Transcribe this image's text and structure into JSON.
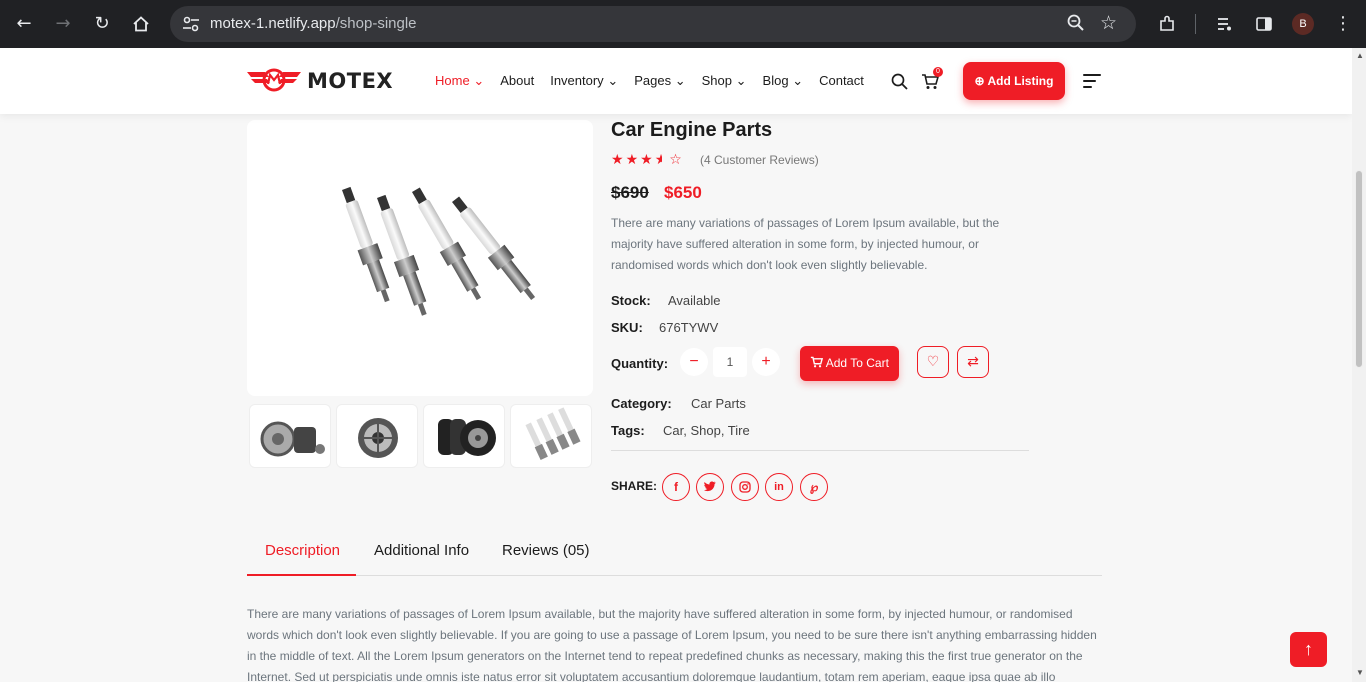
{
  "browser": {
    "url_host": "motex-1.netlify.app",
    "url_path": "/shop-single",
    "profile_initial": "B"
  },
  "nav": {
    "brand": "MOTEX",
    "menu": [
      {
        "label": "Home",
        "has_dropdown": true,
        "active": true
      },
      {
        "label": "About",
        "has_dropdown": false
      },
      {
        "label": "Inventory",
        "has_dropdown": true
      },
      {
        "label": "Pages",
        "has_dropdown": true
      },
      {
        "label": "Shop",
        "has_dropdown": true
      },
      {
        "label": "Blog",
        "has_dropdown": true
      },
      {
        "label": "Contact",
        "has_dropdown": false
      }
    ],
    "cart_count": "0",
    "add_listing_label": "Add Listing",
    "accent_color": "#ef1d26"
  },
  "product": {
    "title": "Car Engine Parts",
    "rating": 3.5,
    "rating_max": 5,
    "reviews_label": "(4 Customer Reviews)",
    "old_price": "$690",
    "new_price": "$650",
    "description": "There are many variations of passages of Lorem Ipsum available, but the majority have suffered alteration in some form, by injected humour, or randomised words which don't look even slightly believable.",
    "stock_label": "Stock:",
    "stock_value": "Available",
    "sku_label": "SKU:",
    "sku_value": "676TYWV",
    "quantity_label": "Quantity:",
    "quantity_value": "1",
    "add_to_cart_label": "Add To Cart",
    "category_label": "Category:",
    "category_value": "Car Parts",
    "tags_label": "Tags:",
    "tags_value": "Car, Shop, Tire",
    "share_label": "SHARE:",
    "thumbnails": [
      "brake-parts",
      "alternator",
      "tires",
      "spark-plugs"
    ]
  },
  "tabs": {
    "items": [
      "Description",
      "Additional Info",
      "Reviews (05)"
    ],
    "active": "Description"
  },
  "long_description": "There are many variations of passages of Lorem Ipsum available, but the majority have suffered alteration in some form, by injected humour, or randomised words which don't look even slightly believable. If you are going to use a passage of Lorem Ipsum, you need to be sure there isn't anything embarrassing hidden in the middle of text. All the Lorem Ipsum generators on the Internet tend to repeat predefined chunks as necessary, making this the first true generator on the Internet. Sed ut perspiciatis unde omnis iste natus error sit voluptatem accusantium doloremque laudantium, totam rem aperiam, eaque ipsa quae ab illo inventore veritatis et"
}
